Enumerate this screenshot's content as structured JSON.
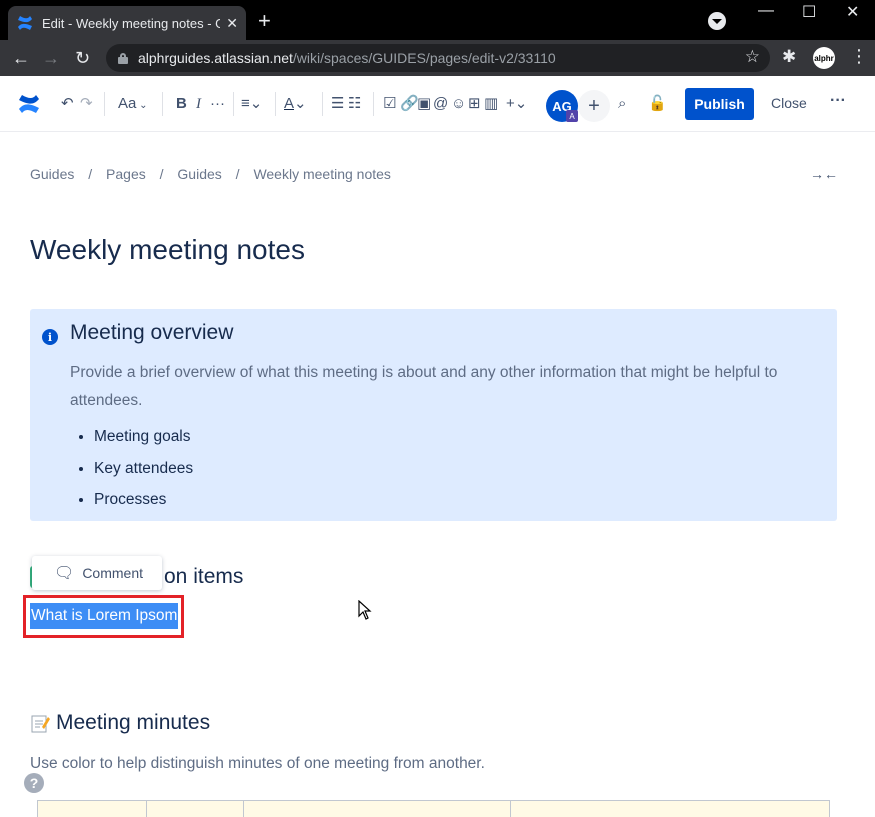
{
  "browser": {
    "tab_title": "Edit - Weekly meeting notes - Gu",
    "tab_close": "✕",
    "new_tab": "+",
    "url_host": "alphrguides.atlassian.net",
    "url_path": "/wiki/spaces/GUIDES/pages/edit-v2/33110",
    "profile_label": "alphr",
    "window_controls": [
      "—",
      "☐",
      "✕"
    ]
  },
  "editor_toolbar": {
    "text_style": "Aa",
    "bold": "B",
    "italic": "I",
    "more": "···",
    "avatar_initials": "AG",
    "avatar_badge": "A",
    "add_collaborator": "+",
    "publish_label": "Publish",
    "close_label": "Close",
    "more_actions": "···"
  },
  "breadcrumb": [
    "Guides",
    "/",
    "Pages",
    "/",
    "Guides",
    "/",
    "Weekly meeting notes"
  ],
  "page": {
    "title": "Weekly meeting notes",
    "info_panel": {
      "icon": "i",
      "heading": "Meeting overview",
      "description": "Provide a brief overview of what this meeting is about and any other information that might be helpful to attendees.",
      "items": [
        "Meeting goals",
        "Key attendees",
        "Processes"
      ]
    },
    "comment_popup": "Comment",
    "action_heading_tail": "on items",
    "selected_text": "What is Lorem Ipsom",
    "minutes_heading": "Meeting minutes",
    "minutes_description": "Use color to help distinguish minutes of one meeting from another.",
    "help": "?"
  },
  "colors": {
    "brand": "#0052cc",
    "info_panel_bg": "#deebff",
    "selection": "#3d8df5",
    "highlight_frame": "#e32227"
  }
}
